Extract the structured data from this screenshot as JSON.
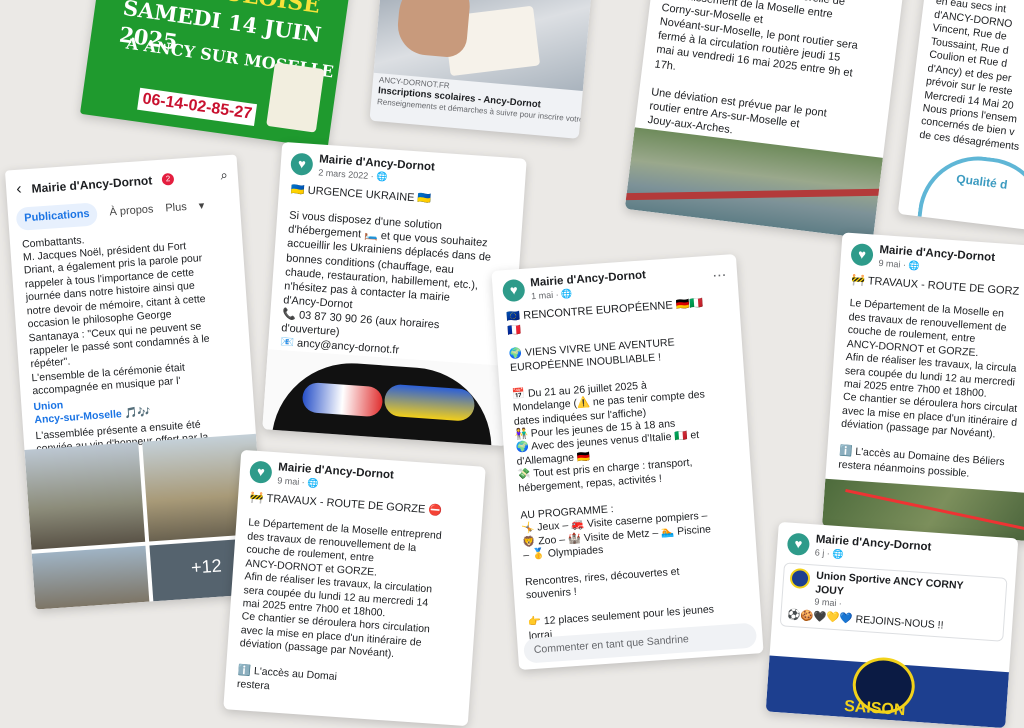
{
  "poster": {
    "line1": "SAMEDI 14 JUIN 2025",
    "line2": "A ANCY SUR MOSELLE",
    "phone": "06-14-02-85-27",
    "top_banner": "GAULOISE"
  },
  "inscriptions": {
    "source": "ANCY-DORNOT.FR",
    "title": "Inscriptions scolaires - Ancy-Dornot",
    "desc": "Renseignements et démarches à suivre pour inscrire votre enfa"
  },
  "passerelle": {
    "text": "cadre de la réalisation d'une\nvisite d'inspection de la passerelle de\nfranchissement de la Moselle entre\nCorny-sur-Moselle et\nNovéant-sur-Moselle, le pont routier sera\nfermé à la circulation routière jeudi 15\nmai au vendredi 16 mai 2025 entre 9h et\n17h.\n\nUne déviation est prévue par le pont\nroutier entre Ars-sur-Moselle et\nJouy-aux-Arches."
  },
  "travaux_top_right": {
    "text": "travaux sur no\nen eau secs int\nd'ANCY-DORNO\nVincent, Rue de\nToussaint, Rue d\nCoulion et Rue d\nd'Ancy) et des per\nprévoir sur le reste\nMercredi 14 Mai 20\nNous prions l'ensem\nconcernés de bien v\nde ces désagréments",
    "badge": "Qualité d"
  },
  "profile": {
    "title": "Mairie d'Ancy-Dornot",
    "badge_count": "2",
    "tabs": [
      "Publications",
      "À propos",
      "Plus"
    ],
    "text": "Combattants.\nM. Jacques Noël, président du Fort\nDriant, a également pris la parole pour\nrappeler à tous l'importance de cette\njournée dans notre histoire ainsi que\nnotre devoir de mémoire, citant à cette\noccasion le philosophe George\nSantanaya : \"Ceux qui ne peuvent se\nrappeler le passé sont condamnés à le\nrépéter\".\nL'ensemble de la cérémonie était\naccompagnée en musique par l'",
    "link1": "Union",
    "link2": "Ancy-sur-Moselle",
    "text2": "L'assemblée présente a ensuite été\nconviée au vin d'honneur offert par la\nmunicipalité.",
    "more_photos": "+12"
  },
  "ukraine": {
    "page": "Mairie d'Ancy-Dornot",
    "date": "2 mars 2022 · ",
    "title": "🇺🇦 URGENCE UKRAINE 🇺🇦",
    "text": "Si vous disposez d'une solution\nd'hébergement 🛏️ et que vous souhaitez\naccueillir les Ukrainiens déplacés dans de\nbonnes conditions (chauffage, eau\nchaude, restauration, habillement, etc.),\nn'hésitez pas à contacter la mairie\nd'Ancy-Dornot\n📞 03 87 30 90 26 (aux horaires\nd'ouverture)\n📧 ancy@ancy-dornot.fr"
  },
  "europe": {
    "page": "Mairie d'Ancy-Dornot",
    "date": "1 mai · ",
    "title": "🇪🇺 RENCONTRE EUROPÉENNE 🇩🇪🇮🇹\n🇫🇷",
    "text": "🌍 VIENS VIVRE UNE AVENTURE\nEUROPÉENNE INOUBLIABLE !\n\n📅 Du 21 au 26 juillet 2025 à\nMondelange (⚠️ ne pas tenir compte des\ndates indiquées sur l'affiche)\n👫 Pour les jeunes de 15 à 18 ans\n🌍 Avec des jeunes venus d'Italie 🇮🇹 et\nd'Allemagne 🇩🇪\n💸 Tout est pris en charge : transport,\nhébergement, repas, activités !\n\nAU PROGRAMME :\n🤸 Jeux – 🚒 Visite caserne pompiers –\n🦁 Zoo – 🏰 Visite de Metz – 🏊 Piscine\n– 🥇 Olympiades\n\nRencontres, rires, découvertes et\nsouvenirs !\n\n👉 12 places seulement pour les jeunes\nlorrai",
    "comment_placeholder": "Commenter en tant que Sandrine"
  },
  "gorze_left": {
    "page": "Mairie d'Ancy-Dornot",
    "date": "9 mai · ",
    "title": "🚧 TRAVAUX - ROUTE DE GORZE ⛔",
    "text": "Le Département de la Moselle entreprend\ndes travaux de renouvellement de la\ncouche de roulement, entre\nANCY-DORNOT et GORZE.\nAfin de réaliser les travaux, la circulation\nsera coupée du lundi 12 au mercredi 14\nmai 2025 entre 7h00 et 18h00.\nCe chantier se déroulera hors circulation\navec la mise en place d'un itinéraire de\ndéviation (passage par Novéant).\n\nℹ️ L'accès au Domai\nrestera"
  },
  "gorze_right": {
    "page": "Mairie d'Ancy-Dornot",
    "date": "9 mai · ",
    "title": "🚧 TRAVAUX - ROUTE DE GORZ",
    "text": "Le Département de la Moselle en\ndes travaux de renouvellement de\ncouche de roulement, entre\nANCY-DORNOT et GORZE.\nAfin de réaliser les travaux, la circula\nsera coupée du lundi 12 au mercredi\nmai 2025 entre 7h00 et 18h00.\nCe chantier se déroulera hors circulat\navec la mise en place d'un itinéraire d\ndéviation (passage par Novéant).\n\nℹ️ L'accès au Domaine des Béliers\nrestera néanmoins possible."
  },
  "sport": {
    "page": "Mairie d'Ancy-Dornot",
    "date": "6 j · ",
    "club": "Union Sportive ANCY CORNY\nJOUY",
    "club_date": "9 mai · ",
    "text": "⚽🍪🖤💛💙 REJOINS-NOUS !!",
    "banner": "SAISON"
  },
  "colors": {
    "background": "#ebe9e6",
    "facebook_blue": "#1b74e4",
    "poster_green": "#1f9a2e",
    "logo_teal": "#2e9b8a"
  }
}
